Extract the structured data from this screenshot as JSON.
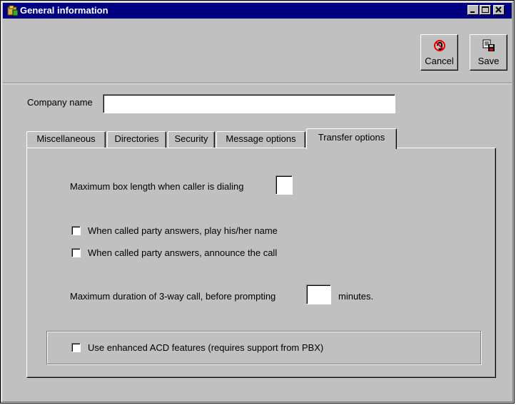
{
  "window": {
    "title": "General information",
    "title_icon": "app-icon",
    "controls": [
      "minimize-icon",
      "maximize-icon",
      "close-icon"
    ]
  },
  "toolbar": {
    "cancel_label": "Cancel",
    "cancel_icon": "cancel-icon",
    "save_label": "Save",
    "save_icon": "save-icon"
  },
  "form": {
    "company_name_label": "Company name",
    "company_name_value": ""
  },
  "tabs": [
    {
      "label": "Miscellaneous",
      "active": false
    },
    {
      "label": "Directories",
      "active": false
    },
    {
      "label": "Security",
      "active": false
    },
    {
      "label": "Message options",
      "active": false
    },
    {
      "label": "Transfer options",
      "active": true
    }
  ],
  "transfer_options": {
    "max_box_length_label": "Maximum box length when caller is dialing",
    "max_box_length_value": "",
    "play_name_label": "When called party answers, play his/her name",
    "play_name_checked": false,
    "announce_call_label": "When called party answers, announce the call",
    "announce_call_checked": false,
    "max_duration_label": "Maximum duration of 3-way call, before prompting",
    "max_duration_value": "",
    "minutes_label": "minutes.",
    "enhanced_acd_label": "Use enhanced ACD features (requires support from PBX)",
    "enhanced_acd_checked": false
  }
}
